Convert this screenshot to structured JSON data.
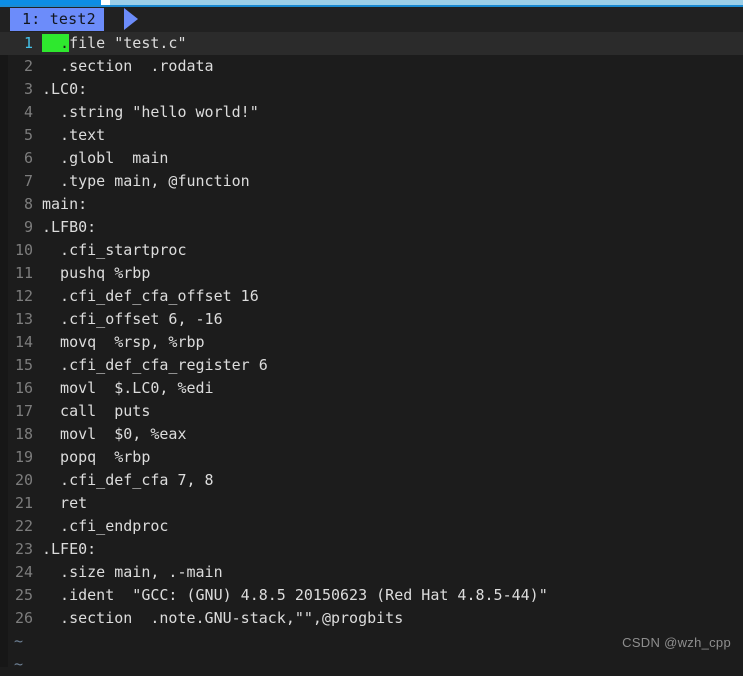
{
  "top_strip": {
    "name": "page-load-progress-bar",
    "filled_color": "#0c8de4",
    "rest_color": "#9ccfe8",
    "gap_color": "#ffffff"
  },
  "tabline": {
    "active_tab_label": "1: test2",
    "active_tab_bg": "#6c8cfa",
    "bg": "#212121"
  },
  "editor": {
    "bg": "#1c1c1c",
    "current_line_bg": "#2b2b2b",
    "text_color": "#dcdcdc",
    "line_number_color": "#7d7d7d",
    "current_line_number_color": "#44c1e8",
    "cursor_color": "#2ee82e",
    "cursor_line": 1,
    "cursor_char": ".",
    "lines": [
      {
        "num": "1",
        "text": ".file \"test.c\"",
        "indent": true,
        "cursor": true
      },
      {
        "num": "2",
        "text": ".section  .rodata",
        "indent": true,
        "cursor": false
      },
      {
        "num": "3",
        "text": ".LC0:",
        "indent": false,
        "cursor": false
      },
      {
        "num": "4",
        "text": ".string \"hello world!\"",
        "indent": true,
        "cursor": false
      },
      {
        "num": "5",
        "text": ".text",
        "indent": true,
        "cursor": false
      },
      {
        "num": "6",
        "text": ".globl  main",
        "indent": true,
        "cursor": false
      },
      {
        "num": "7",
        "text": ".type main, @function",
        "indent": true,
        "cursor": false
      },
      {
        "num": "8",
        "text": "main:",
        "indent": false,
        "cursor": false
      },
      {
        "num": "9",
        "text": ".LFB0:",
        "indent": false,
        "cursor": false
      },
      {
        "num": "10",
        "text": ".cfi_startproc",
        "indent": true,
        "cursor": false
      },
      {
        "num": "11",
        "text": "pushq %rbp",
        "indent": true,
        "cursor": false
      },
      {
        "num": "12",
        "text": ".cfi_def_cfa_offset 16",
        "indent": true,
        "cursor": false
      },
      {
        "num": "13",
        "text": ".cfi_offset 6, -16",
        "indent": true,
        "cursor": false
      },
      {
        "num": "14",
        "text": "movq  %rsp, %rbp",
        "indent": true,
        "cursor": false
      },
      {
        "num": "15",
        "text": ".cfi_def_cfa_register 6",
        "indent": true,
        "cursor": false
      },
      {
        "num": "16",
        "text": "movl  $.LC0, %edi",
        "indent": true,
        "cursor": false
      },
      {
        "num": "17",
        "text": "call  puts",
        "indent": true,
        "cursor": false
      },
      {
        "num": "18",
        "text": "movl  $0, %eax",
        "indent": true,
        "cursor": false
      },
      {
        "num": "19",
        "text": "popq  %rbp",
        "indent": true,
        "cursor": false
      },
      {
        "num": "20",
        "text": ".cfi_def_cfa 7, 8",
        "indent": true,
        "cursor": false
      },
      {
        "num": "21",
        "text": "ret",
        "indent": true,
        "cursor": false
      },
      {
        "num": "22",
        "text": ".cfi_endproc",
        "indent": true,
        "cursor": false
      },
      {
        "num": "23",
        "text": ".LFE0:",
        "indent": false,
        "cursor": false
      },
      {
        "num": "24",
        "text": ".size main, .-main",
        "indent": true,
        "cursor": false
      },
      {
        "num": "25",
        "text": ".ident  \"GCC: (GNU) 4.8.5 20150623 (Red Hat 4.8.5-44)\"",
        "indent": true,
        "cursor": false
      },
      {
        "num": "26",
        "text": ".section  .note.GNU-stack,\"\",@progbits",
        "indent": true,
        "cursor": false
      }
    ],
    "empty_line_marker": "~",
    "empty_line_marker_color": "#6d7f93",
    "empty_line_count": 2
  },
  "watermark": {
    "text": "CSDN @wzh_cpp",
    "color": "#8e8e8e"
  }
}
